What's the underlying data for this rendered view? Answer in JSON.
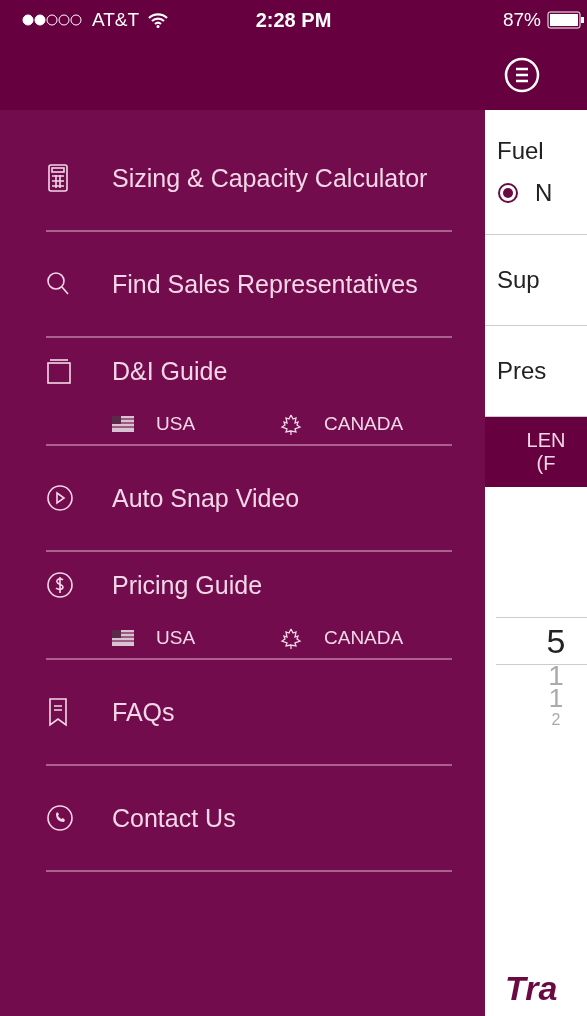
{
  "status_bar": {
    "carrier": "AT&T",
    "time": "2:28 PM",
    "battery": "87%"
  },
  "drawer": {
    "items": [
      {
        "label": "Sizing & Capacity Calculator",
        "kind": "plain"
      },
      {
        "label": "Find Sales Representatives",
        "kind": "plain"
      },
      {
        "label": "D&I Guide",
        "kind": "regional",
        "links": [
          "USA",
          "CANADA"
        ]
      },
      {
        "label": "Auto Snap Video",
        "kind": "plain"
      },
      {
        "label": "Pricing Guide",
        "kind": "regional",
        "links": [
          "USA",
          "CANADA"
        ]
      },
      {
        "label": "FAQs",
        "kind": "plain"
      },
      {
        "label": "Contact Us",
        "kind": "plain"
      }
    ]
  },
  "content": {
    "fuel_label": "Fuel",
    "fuel_option": {
      "label": "N",
      "selected": true
    },
    "rows": [
      "Sup",
      "Pres"
    ],
    "column_header": [
      "LEN",
      "(F"
    ],
    "picker": [
      {
        "value": "5",
        "selected": true
      },
      {
        "value": "1",
        "selected": false
      },
      {
        "value": "1",
        "selected": false
      },
      {
        "value": "2",
        "selected": false
      }
    ],
    "logo": "Tra"
  }
}
